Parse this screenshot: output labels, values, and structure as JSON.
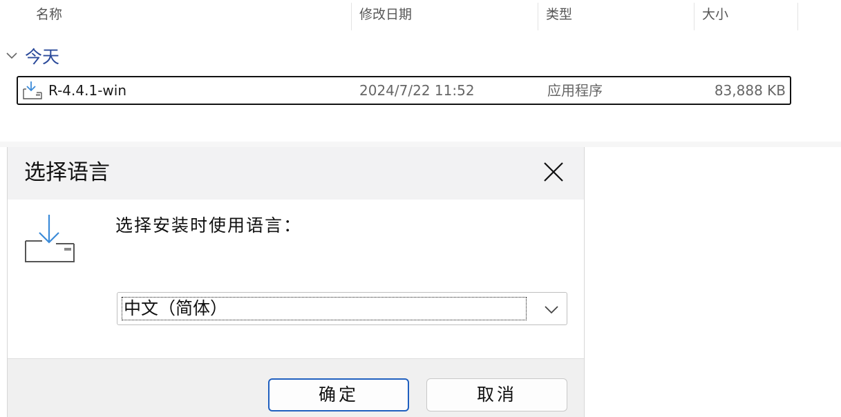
{
  "explorer": {
    "columns": {
      "name": "名称",
      "modified": "修改日期",
      "type": "类型",
      "size": "大小"
    },
    "group": {
      "title": "今天",
      "chevron_icon": "chevron-down-icon"
    },
    "file": {
      "icon": "installer-download-icon",
      "name": "R-4.4.1-win",
      "modified": "2024/7/22 11:52",
      "type": "应用程序",
      "size": "83,888 KB"
    }
  },
  "dialog": {
    "title": "选择语言",
    "close_icon": "close-icon",
    "installer_icon": "installer-download-icon",
    "prompt": "选择安装时使用语言：",
    "language_select": {
      "selected": "中文（简体）",
      "chevron_icon": "chevron-down-icon"
    },
    "buttons": {
      "ok": "确定",
      "cancel": "取消"
    },
    "colors": {
      "accent": "#1f5fbf",
      "group_header": "#2b4a9a",
      "icon_blue": "#3a8ad8"
    }
  }
}
